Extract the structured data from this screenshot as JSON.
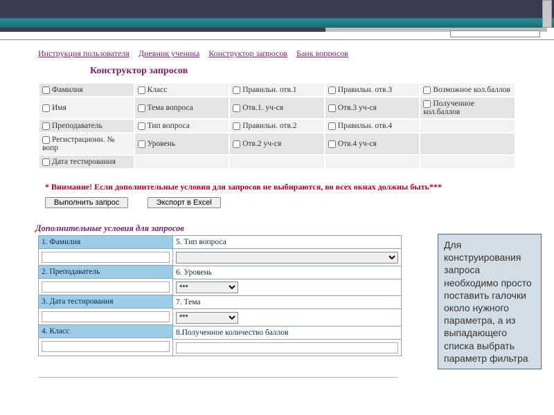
{
  "nav": {
    "instruction": "Инструкция пользователя",
    "diary": "Дневник ученика",
    "builder": "Конструктор запросов",
    "bank": "Банк вопросов"
  },
  "title": "Конструктор запросов",
  "grid": {
    "r1": [
      "Фамилия",
      "Класс",
      "Правильн. отв.1",
      "Правильн. отв.3",
      "Возможное кол.баллов"
    ],
    "r2": [
      "Имя",
      "Тема вопроса",
      "Отв.1. уч-ся",
      "Отв.3 уч-ся",
      "Полученное кол.баллов"
    ],
    "r3": [
      "Преподаватель",
      "Тип вопроса",
      "Правильн. отв.2",
      "Правильн. отв.4",
      ""
    ],
    "r4": [
      "Регистрационн. № вопр",
      "Уровень",
      "Отв.2 уч-ся",
      "Отв.4 уч-ся",
      ""
    ],
    "r5": [
      "Дата тестирования",
      "",
      "",
      "",
      ""
    ]
  },
  "warning": "* Внимание! Если дополнительные условия для запросов не выбираются, во всех окнах должны быть***",
  "buttons": {
    "run": "Выполнить запрос",
    "export": "Экспорт в Excel"
  },
  "cond_title": "Дополнительные условия для запросов",
  "cond_left": {
    "h1": "1. Фамилия",
    "h2": "2. Преподаватель",
    "h3": "3. Дата тестирования",
    "h4": "4. Класс"
  },
  "cond_right": {
    "h5": "5. Тип вопроса",
    "h6": "6. Уровень",
    "h7": "7. Тема",
    "h8": "8.Полученное количество  баллов",
    "opt_star": "***"
  },
  "callout": "Для конструирования запроса необходимо просто поставить галочки около нужного параметра, а из выпадающего списка выбрать  параметр фильтра"
}
